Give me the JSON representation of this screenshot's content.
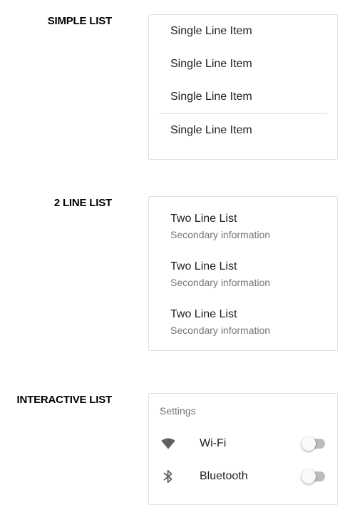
{
  "sections": {
    "simple": {
      "label": "SIMPLE LIST",
      "items": [
        "Single Line Item",
        "Single Line Item",
        "Single Line Item",
        "Single Line Item"
      ]
    },
    "two_line": {
      "label": "2 LINE LIST",
      "items": [
        {
          "primary": "Two Line List",
          "secondary": "Secondary information"
        },
        {
          "primary": "Two Line List",
          "secondary": "Secondary information"
        },
        {
          "primary": "Two Line List",
          "secondary": "Secondary information"
        }
      ]
    },
    "interactive": {
      "label": "INTERACTIVE LIST",
      "subheader": "Settings",
      "items": [
        {
          "label": "Wi-Fi",
          "icon": "wifi-icon",
          "enabled": false
        },
        {
          "label": "Bluetooth",
          "icon": "bluetooth-icon",
          "enabled": false
        }
      ]
    }
  },
  "colors": {
    "border": "#e0e0e0",
    "primary_text": "#212121",
    "secondary_text": "#757575",
    "switch_track_off": "#bdbdbd",
    "switch_thumb_off": "#fafafa"
  }
}
